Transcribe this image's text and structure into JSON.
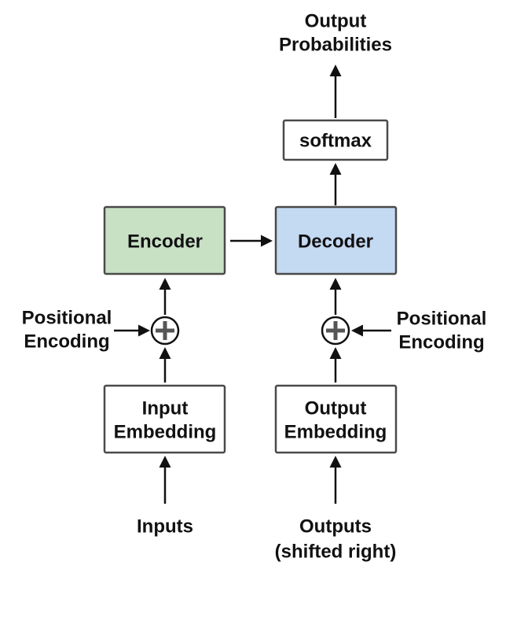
{
  "diagram": {
    "top_output_line1": "Output",
    "top_output_line2": "Probabilities",
    "softmax": "softmax",
    "encoder": "Encoder",
    "decoder": "Decoder",
    "pos_enc_left_line1": "Positional",
    "pos_enc_left_line2": "Encoding",
    "pos_enc_right_line1": "Positional",
    "pos_enc_right_line2": "Encoding",
    "input_emb_line1": "Input",
    "input_emb_line2": "Embedding",
    "output_emb_line1": "Output",
    "output_emb_line2": "Embedding",
    "inputs_label": "Inputs",
    "outputs_label_line1": "Outputs",
    "outputs_label_line2": "(shifted right)",
    "colors": {
      "encoder_fill": "#c8e1c5",
      "decoder_fill": "#c4d9f2",
      "box_fill": "#ffffff"
    }
  }
}
